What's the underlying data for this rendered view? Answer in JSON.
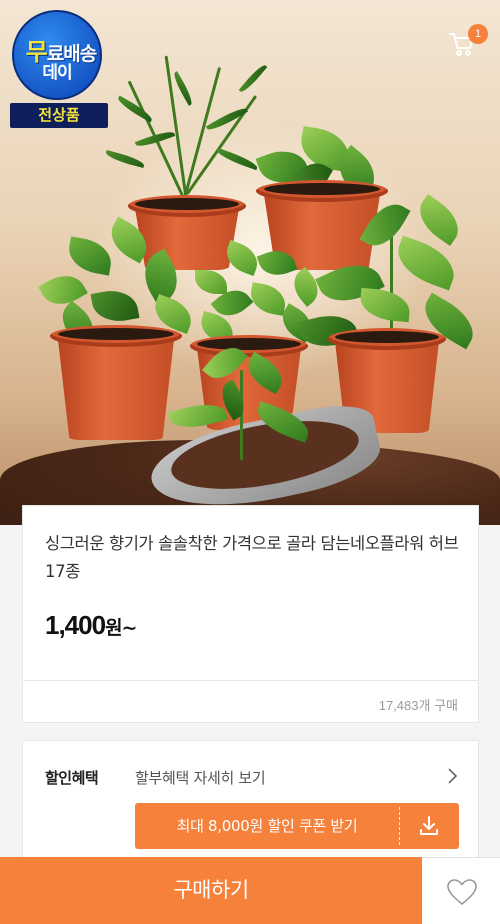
{
  "badge": {
    "line1_first": "무",
    "line1_rest": "료배송",
    "line2": "데이",
    "bar": "전상품"
  },
  "header": {
    "cart_icon": "cart-icon",
    "cart_count": "1"
  },
  "product": {
    "title": "싱그러운 향기가 솔솔착한 가격으로 골라 담는네오플라워 허브 17종",
    "price_value": "1,400",
    "price_unit": "원~",
    "purchase_count": "17,483개 구매"
  },
  "discount": {
    "label": "할인혜택",
    "link": "할부혜택 자세히 보기",
    "coupon_button": "최대 8,000원 할인 쿠폰 받기",
    "coupon_icon": "download-icon"
  },
  "bottom": {
    "buy_button": "구매하기",
    "wish_icon": "heart-icon"
  },
  "colors": {
    "accent": "#f5813b",
    "badge_blue": "#1553c4",
    "badge_navy": "#0e1f5c",
    "badge_yellow": "#f3e53a"
  }
}
